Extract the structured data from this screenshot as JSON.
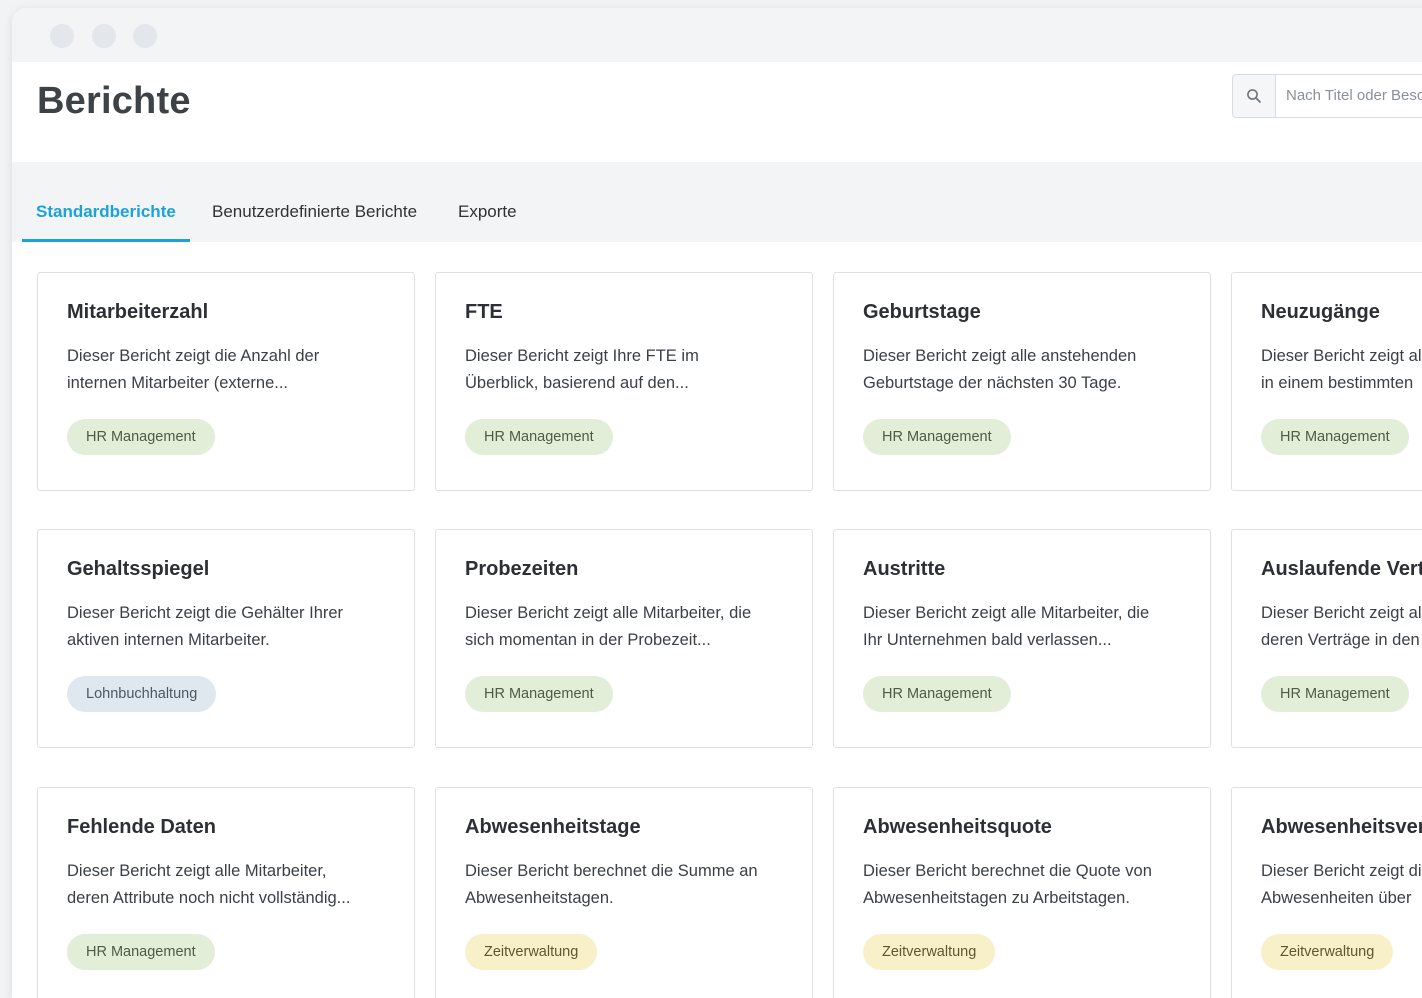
{
  "page": {
    "title": "Berichte"
  },
  "search": {
    "placeholder": "Nach Titel oder Beschreibung suchen"
  },
  "tabs": [
    {
      "label": "Standardberichte",
      "active": true
    },
    {
      "label": "Benutzerdefinierte Berichte",
      "active": false
    },
    {
      "label": "Exporte",
      "active": false
    }
  ],
  "cards": [
    {
      "title": "Mitarbeiterzahl",
      "desc_1": "Dieser Bericht zeigt die Anzahl der",
      "desc_2": "internen Mitarbeiter (externe...",
      "tag": "HR Management"
    },
    {
      "title": "FTE",
      "desc_1": "Dieser Bericht zeigt Ihre FTE im",
      "desc_2": "Überblick, basierend auf den...",
      "tag": "HR Management"
    },
    {
      "title": "Geburtstage",
      "desc_1": "Dieser Bericht zeigt alle anstehenden",
      "desc_2": "Geburtstage der nächsten 30 Tage.",
      "tag": "HR Management"
    },
    {
      "title": "Neuzugänge",
      "desc_1": "Dieser Bericht zeigt alle",
      "desc_2": "in einem bestimmten",
      "tag": "HR Management"
    },
    {
      "title": "Gehaltsspiegel",
      "desc_1": "Dieser Bericht zeigt die Gehälter Ihrer",
      "desc_2": "aktiven internen Mitarbeiter.",
      "tag": "Lohnbuchhaltung"
    },
    {
      "title": "Probezeiten",
      "desc_1": "Dieser Bericht zeigt alle Mitarbeiter, die",
      "desc_2": "sich momentan in der Probezeit...",
      "tag": "HR Management"
    },
    {
      "title": "Austritte",
      "desc_1": "Dieser Bericht zeigt alle Mitarbeiter, die",
      "desc_2": "Ihr Unternehmen bald verlassen...",
      "tag": "HR Management"
    },
    {
      "title": "Auslaufende Verträge",
      "desc_1": "Dieser Bericht zeigt alle",
      "desc_2": "deren Verträge in den",
      "tag": "HR Management"
    },
    {
      "title": "Fehlende Daten",
      "desc_1": "Dieser Bericht zeigt alle Mitarbeiter,",
      "desc_2": "deren Attribute noch nicht vollständig...",
      "tag": "HR Management"
    },
    {
      "title": "Abwesenheitstage",
      "desc_1": "Dieser Bericht berechnet die Summe an",
      "desc_2": "Abwesenheitstagen.",
      "tag": "Zeitverwaltung"
    },
    {
      "title": "Abwesenheitsquote",
      "desc_1": "Dieser Bericht berechnet die Quote von",
      "desc_2": "Abwesenheitstagen zu Arbeitstagen.",
      "tag": "Zeitverwaltung"
    },
    {
      "title": "Abwesenheitsverteilung",
      "desc_1": "Dieser Bericht zeigt die",
      "desc_2": "Abwesenheiten über",
      "tag": "Zeitverwaltung"
    }
  ],
  "tag_colors": {
    "HR Management": "#e2eed8",
    "Lohnbuchhaltung": "#dfe8ef",
    "Zeitverwaltung": "#f7f0c9"
  },
  "accent_color": "#1ca3d6",
  "icons": {
    "search": "search-icon",
    "window_controls": [
      "window-close-dot",
      "window-minimize-dot",
      "window-maximize-dot"
    ]
  }
}
